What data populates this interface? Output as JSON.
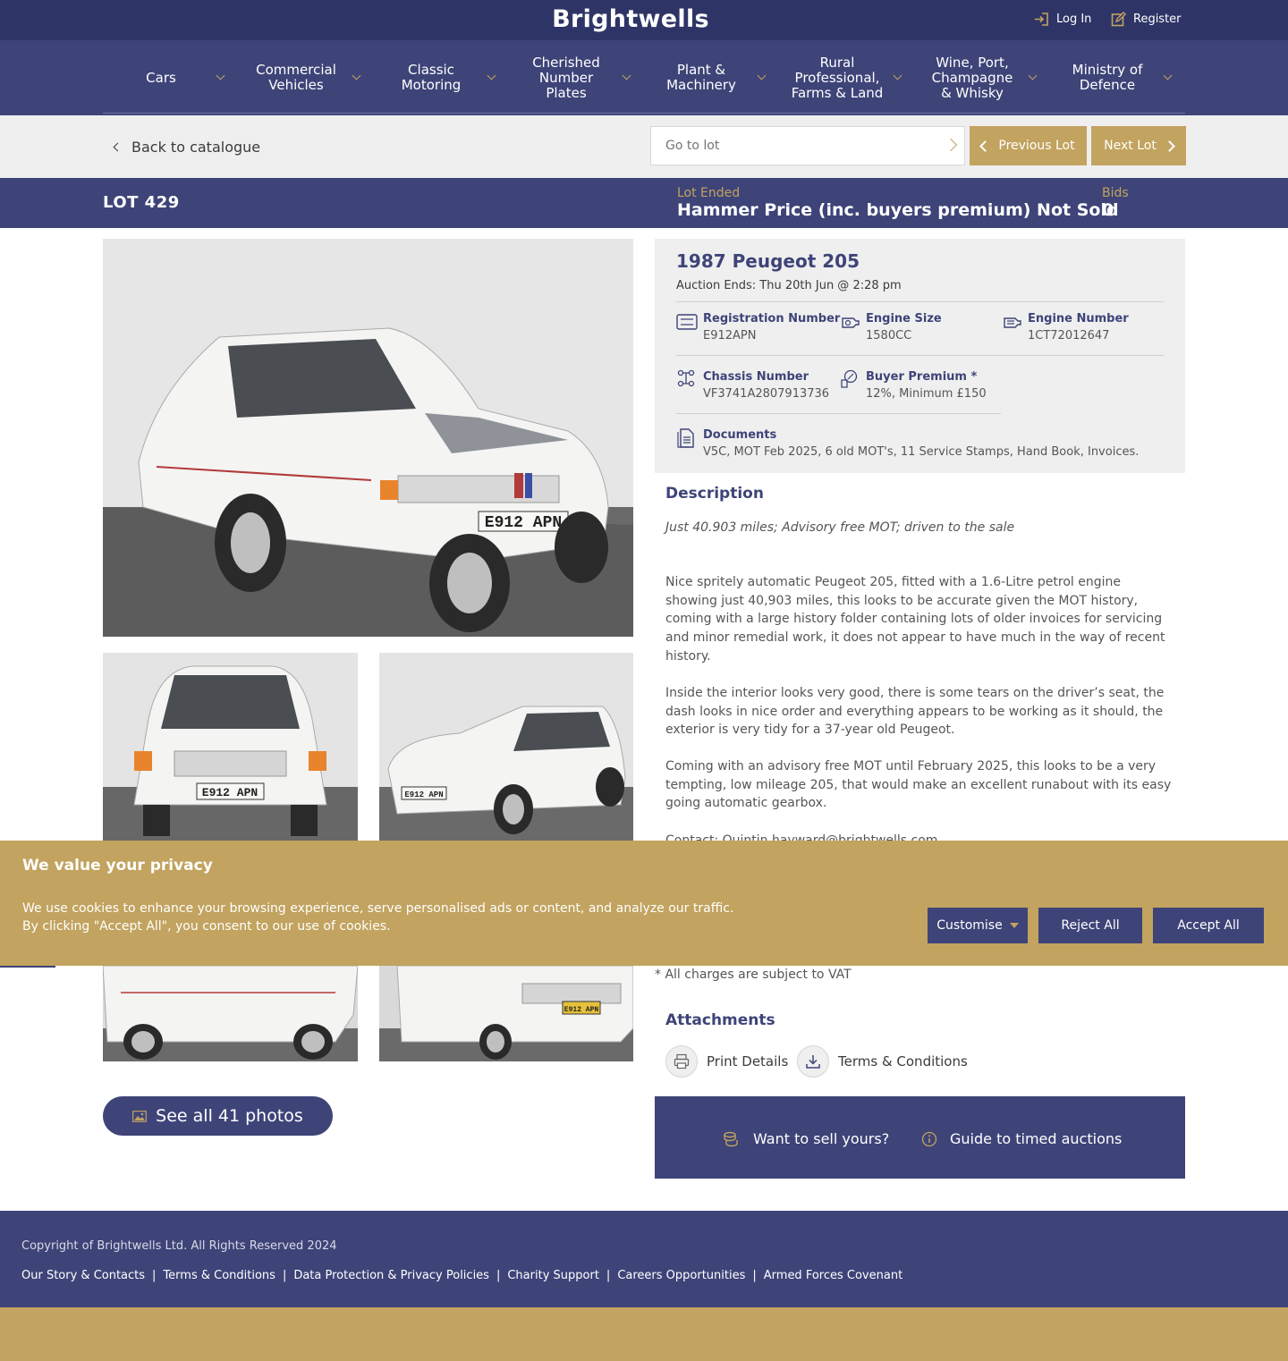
{
  "header": {
    "logo": "Brightwells",
    "login": "Log In",
    "register": "Register"
  },
  "nav": [
    {
      "label": "Cars"
    },
    {
      "label": "Commercial Vehicles"
    },
    {
      "label": "Classic Motoring"
    },
    {
      "label": "Cherished Number Plates"
    },
    {
      "label": "Plant & Machinery"
    },
    {
      "label": "Rural Professional, Farms & Land"
    },
    {
      "label": "Wine, Port, Champagne & Whisky"
    },
    {
      "label": "Ministry of Defence"
    }
  ],
  "subbar": {
    "back": "Back to catalogue",
    "goto_placeholder": "Go to lot",
    "prev": "Previous Lot",
    "next": "Next Lot"
  },
  "lot": {
    "number": "LOT 429",
    "status_label": "Lot Ended",
    "status_value": "Hammer Price (inc. buyers premium) Not Sold",
    "bids_label": "Bids",
    "bids_value": "0"
  },
  "vehicle": {
    "title": "1987 Peugeot 205",
    "auction_ends": "Auction Ends: Thu 20th Jun @ 2:28 pm",
    "specs": {
      "reg_label": "Registration Number",
      "reg_value": "E912APN",
      "engine_size_label": "Engine Size",
      "engine_size_value": "1580CC",
      "engine_no_label": "Engine Number",
      "engine_no_value": "1CT72012647",
      "chassis_label": "Chassis Number",
      "chassis_value": "VF3741A2807913736",
      "premium_label": "Buyer Premium *",
      "premium_value": "12%, Minimum £150",
      "docs_label": "Documents",
      "docs_value": "V5C, MOT Feb 2025, 6 old MOT's, 11 Service Stamps, Hand Book, Invoices."
    },
    "plate": "E912 APN"
  },
  "description": {
    "heading": "Description",
    "lead": "Just 40.903 miles; Advisory free MOT; driven to the sale",
    "p1": "Nice spritely automatic Peugeot 205, fitted with a 1.6-Litre petrol engine showing just 40,903 miles, this looks to be accurate given the MOT history, coming with a large history folder containing lots of older invoices for servicing and minor remedial work, it does not appear to have much in the way of recent history.",
    "p2": "Inside the interior looks very good, there is some tears on the driver’s seat, the dash looks in nice order and everything appears to be working as it should, the exterior is very tidy for a 37-year old Peugeot.",
    "p3": "Coming with an advisory free MOT until February 2025, this looks to be a very tempting, low mileage 205, that would make an excellent runabout with its easy going automatic gearbox.",
    "contact": "Contact: Quintin.hayward@brightwells.com"
  },
  "vat_note": "* All charges are subject to VAT",
  "attachments": {
    "heading": "Attachments",
    "print": "Print Details",
    "terms": "Terms & Conditions"
  },
  "photos_button": "See all 41 photos",
  "sell": {
    "want": "Want to sell yours?",
    "guide": "Guide to timed auctions"
  },
  "cookie": {
    "title": "We value your privacy",
    "text": "We use cookies to enhance your browsing experience, serve personalised ads or content, and analyze our traffic. By clicking \"Accept All\", you consent to our use of cookies.",
    "customise": "Customise",
    "reject": "Reject All",
    "accept": "Accept All"
  },
  "footer": {
    "copyright": "Copyright of Brightwells Ltd. All Rights Reserved 2024",
    "links": [
      "Our Story & Contacts",
      "Terms & Conditions",
      "Data Protection & Privacy Policies",
      "Charity Support",
      "Careers Opportunities",
      "Armed Forces Covenant"
    ],
    "separator": "|"
  },
  "colors": {
    "navy": "#3e4478",
    "dark_navy": "#2e3566",
    "gold": "#c2a35f",
    "light_grey": "#efefef"
  },
  "icons": [
    "login-icon",
    "register-icon",
    "chevron-down-icon",
    "chevron-left-icon",
    "chevron-right-icon",
    "registration-icon",
    "engine-icon",
    "engine-number-icon",
    "chassis-icon",
    "premium-icon",
    "documents-icon",
    "print-icon",
    "download-icon",
    "image-icon",
    "coins-icon",
    "info-icon"
  ]
}
